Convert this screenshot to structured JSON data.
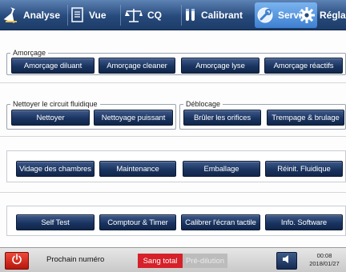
{
  "toolbar": {
    "tabs": [
      {
        "label": "Analyse",
        "icon": "flask-icon"
      },
      {
        "label": "Vue",
        "icon": "document-icon"
      },
      {
        "label": "CQ",
        "icon": "balance-icon"
      },
      {
        "label": "Calibrant",
        "icon": "vials-icon"
      },
      {
        "label": "Service",
        "icon": "wrench-globe-icon",
        "active": true
      },
      {
        "label": "Réglage",
        "icon": "gear-icon"
      }
    ]
  },
  "amorcage": {
    "legend": "Amorçage",
    "buttons": [
      "Amorçage diluant",
      "Amorçage cleaner",
      "Amorçage lyse",
      "Amorçage réactifs"
    ]
  },
  "nettoyer": {
    "legend": "Nettoyer le circuit fluidique",
    "buttons": [
      "Nettoyer",
      "Nettoyage puissant"
    ]
  },
  "deblocage": {
    "legend": "Déblocage",
    "buttons": [
      "Brûler les orifices",
      "Trempage & brulage"
    ]
  },
  "maintenance_row": {
    "buttons": [
      "Vidage des chambres",
      "Maintenance",
      "Emballage",
      "Réinit. Fluidique"
    ]
  },
  "tools_row": {
    "buttons": [
      "Self Test",
      "Comptour & Timer",
      "Calibrer l'écran tactile",
      "Info. Software"
    ]
  },
  "status": {
    "next_number_label": "Prochain numéro",
    "mode_active": "Sang total",
    "mode_inactive": "Pré-dilution",
    "time": "00:08",
    "date": "2018/01/27"
  },
  "colors": {
    "toolbar": "#274a7c",
    "active_tab": "#4f93e0",
    "button": "#1a3461",
    "power": "#d6202a",
    "mode_active": "#d6202a"
  }
}
